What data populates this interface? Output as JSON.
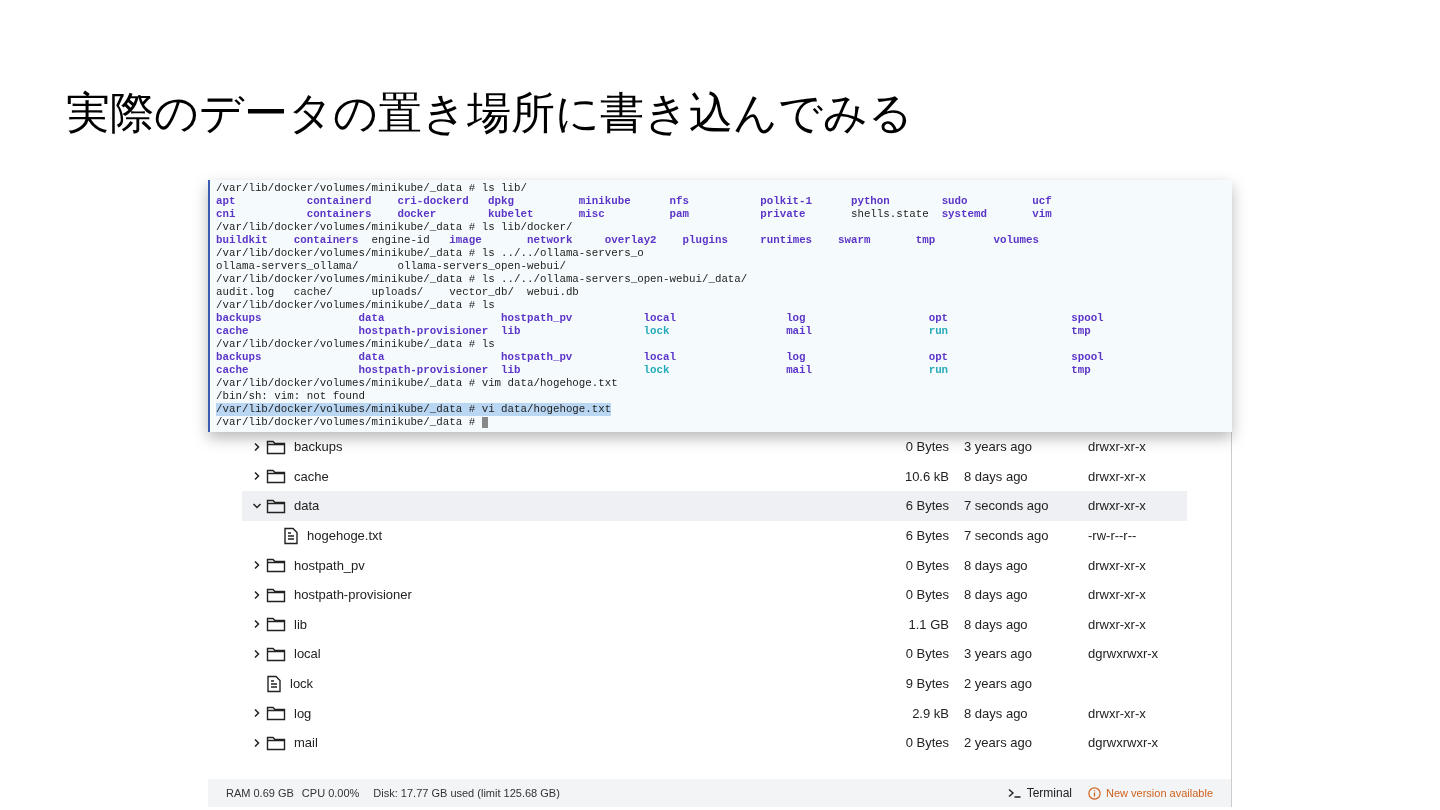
{
  "slide_title": "実際のデータの置き場所に書き込んでみる",
  "terminal": {
    "lines": [
      {
        "kind": "command",
        "text": "/var/lib/docker/volumes/minikube/_data # ls lib/",
        "selected": false
      },
      {
        "kind": "listing",
        "items": [
          {
            "name": "apt",
            "kind": "dir"
          },
          {
            "name": "containerd",
            "kind": "dir"
          },
          {
            "name": "cri-dockerd",
            "kind": "dir"
          },
          {
            "name": "dpkg",
            "kind": "dir"
          },
          {
            "name": "minikube",
            "kind": "dir"
          },
          {
            "name": "nfs",
            "kind": "dir"
          },
          {
            "name": "polkit-1",
            "kind": "dir"
          },
          {
            "name": "python",
            "kind": "dir"
          },
          {
            "name": "sudo",
            "kind": "dir"
          },
          {
            "name": "ucf",
            "kind": "dir"
          }
        ]
      },
      {
        "kind": "listing",
        "items": [
          {
            "name": "cni",
            "kind": "dir"
          },
          {
            "name": "containers",
            "kind": "dir"
          },
          {
            "name": "docker",
            "kind": "dir"
          },
          {
            "name": "kubelet",
            "kind": "dir"
          },
          {
            "name": "misc",
            "kind": "dir"
          },
          {
            "name": "pam",
            "kind": "dir"
          },
          {
            "name": "private",
            "kind": "dir"
          },
          {
            "name": "shells.state",
            "kind": "file"
          },
          {
            "name": "systemd",
            "kind": "dir"
          },
          {
            "name": "vim",
            "kind": "dir"
          }
        ]
      },
      {
        "kind": "command",
        "text": "/var/lib/docker/volumes/minikube/_data # ls lib/docker/",
        "selected": false
      },
      {
        "kind": "listing",
        "items": [
          {
            "name": "buildkit",
            "kind": "dir"
          },
          {
            "name": "containers",
            "kind": "dir"
          },
          {
            "name": "engine-id",
            "kind": "file"
          },
          {
            "name": "image",
            "kind": "dir"
          },
          {
            "name": "network",
            "kind": "dir"
          },
          {
            "name": "overlay2",
            "kind": "dir"
          },
          {
            "name": "plugins",
            "kind": "dir"
          },
          {
            "name": "runtimes",
            "kind": "dir"
          },
          {
            "name": "swarm",
            "kind": "dir"
          },
          {
            "name": "tmp",
            "kind": "dir"
          },
          {
            "name": "volumes",
            "kind": "dir"
          }
        ]
      },
      {
        "kind": "command",
        "text": "/var/lib/docker/volumes/minikube/_data # ls ../../ollama-servers_o",
        "selected": false
      },
      {
        "kind": "output",
        "text": "ollama-servers_ollama/      ollama-servers_open-webui/"
      },
      {
        "kind": "command",
        "text": "/var/lib/docker/volumes/minikube/_data # ls ../../ollama-servers_open-webui/_data/",
        "selected": false
      },
      {
        "kind": "output",
        "text": "audit.log   cache/      uploads/    vector_db/  webui.db"
      },
      {
        "kind": "command",
        "text": "/var/lib/docker/volumes/minikube/_data # ls",
        "selected": false
      },
      {
        "kind": "listing",
        "items": [
          {
            "name": "backups",
            "kind": "dir"
          },
          {
            "name": "data",
            "kind": "dir"
          },
          {
            "name": "hostpath_pv",
            "kind": "dir"
          },
          {
            "name": "local",
            "kind": "dir"
          },
          {
            "name": "log",
            "kind": "dir"
          },
          {
            "name": "opt",
            "kind": "dir"
          },
          {
            "name": "spool",
            "kind": "dir"
          }
        ]
      },
      {
        "kind": "listing",
        "items": [
          {
            "name": "cache",
            "kind": "dir"
          },
          {
            "name": "hostpath-provisioner",
            "kind": "dir"
          },
          {
            "name": "lib",
            "kind": "dir"
          },
          {
            "name": "lock",
            "kind": "link"
          },
          {
            "name": "mail",
            "kind": "dir"
          },
          {
            "name": "run",
            "kind": "link"
          },
          {
            "name": "tmp",
            "kind": "dir"
          }
        ]
      },
      {
        "kind": "command",
        "text": "/var/lib/docker/volumes/minikube/_data # ls",
        "selected": false
      },
      {
        "kind": "listing",
        "items": [
          {
            "name": "backups",
            "kind": "dir"
          },
          {
            "name": "data",
            "kind": "dir"
          },
          {
            "name": "hostpath_pv",
            "kind": "dir"
          },
          {
            "name": "local",
            "kind": "dir"
          },
          {
            "name": "log",
            "kind": "dir"
          },
          {
            "name": "opt",
            "kind": "dir"
          },
          {
            "name": "spool",
            "kind": "dir"
          }
        ]
      },
      {
        "kind": "listing",
        "items": [
          {
            "name": "cache",
            "kind": "dir"
          },
          {
            "name": "hostpath-provisioner",
            "kind": "dir"
          },
          {
            "name": "lib",
            "kind": "dir"
          },
          {
            "name": "lock",
            "kind": "link"
          },
          {
            "name": "mail",
            "kind": "dir"
          },
          {
            "name": "run",
            "kind": "link"
          },
          {
            "name": "tmp",
            "kind": "dir"
          }
        ]
      },
      {
        "kind": "command",
        "text": "/var/lib/docker/volumes/minikube/_data # vim data/hogehoge.txt",
        "selected": false
      },
      {
        "kind": "output",
        "text": "/bin/sh: vim: not found"
      },
      {
        "kind": "command",
        "text": "/var/lib/docker/volumes/minikube/_data # vi data/hogehoge.txt",
        "selected": true
      },
      {
        "kind": "prompt",
        "text": "/var/lib/docker/volumes/minikube/_data #"
      }
    ]
  },
  "files": [
    {
      "kind": "folder",
      "name": "backups",
      "expanded": false,
      "selected": false,
      "size": "0 Bytes",
      "modified": "3 years ago",
      "permissions": "drwxr-xr-x"
    },
    {
      "kind": "folder",
      "name": "cache",
      "expanded": false,
      "selected": false,
      "size": "10.6 kB",
      "modified": "8 days ago",
      "permissions": "drwxr-xr-x"
    },
    {
      "kind": "folder",
      "name": "data",
      "expanded": true,
      "selected": true,
      "size": "6 Bytes",
      "modified": "7 seconds ago",
      "permissions": "drwxr-xr-x",
      "children": [
        {
          "kind": "file",
          "name": "hogehoge.txt",
          "selected": false,
          "size": "6 Bytes",
          "modified": "7 seconds ago",
          "permissions": "-rw-r--r--"
        }
      ]
    },
    {
      "kind": "folder",
      "name": "hostpath_pv",
      "expanded": false,
      "selected": false,
      "size": "0 Bytes",
      "modified": "8 days ago",
      "permissions": "drwxr-xr-x"
    },
    {
      "kind": "folder",
      "name": "hostpath-provisioner",
      "expanded": false,
      "selected": false,
      "size": "0 Bytes",
      "modified": "8 days ago",
      "permissions": "drwxr-xr-x"
    },
    {
      "kind": "folder",
      "name": "lib",
      "expanded": false,
      "selected": false,
      "size": "1.1 GB",
      "modified": "8 days ago",
      "permissions": "drwxr-xr-x"
    },
    {
      "kind": "folder",
      "name": "local",
      "expanded": false,
      "selected": false,
      "size": "0 Bytes",
      "modified": "3 years ago",
      "permissions": "dgrwxrwxr-x"
    },
    {
      "kind": "file",
      "name": "lock",
      "selected": false,
      "size": "9 Bytes",
      "modified": "2 years ago"
    },
    {
      "kind": "folder",
      "name": "log",
      "expanded": false,
      "selected": false,
      "size": "2.9 kB",
      "modified": "8 days ago",
      "permissions": "drwxr-xr-x"
    },
    {
      "kind": "folder",
      "name": "mail",
      "expanded": false,
      "selected": false,
      "size": "0 Bytes",
      "modified": "2 years ago",
      "permissions": "dgrwxrwxr-x"
    }
  ],
  "status_bar": {
    "ram": "RAM 0.69 GB",
    "cpu": "CPU 0.00%",
    "disk": "Disk: 17.77 GB used (limit 125.68 GB)",
    "terminal": "Terminal",
    "update": "New version available"
  }
}
